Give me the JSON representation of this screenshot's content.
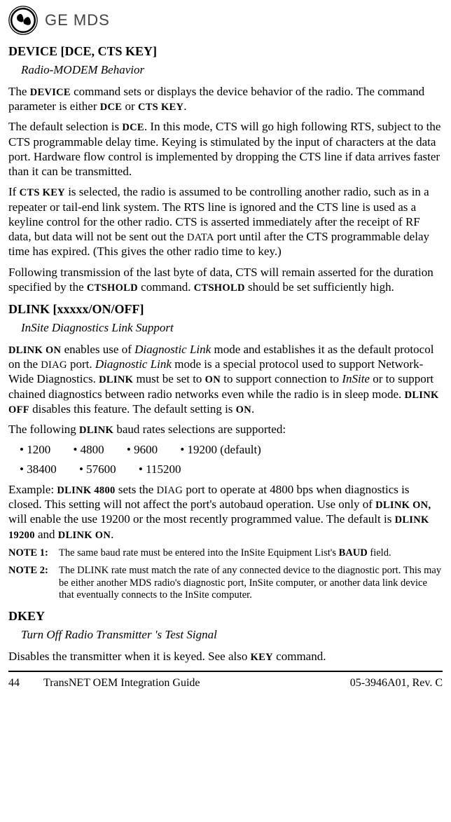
{
  "logo": {
    "brand_text": "GE MDS"
  },
  "sections": {
    "device": {
      "title": "DEVICE [DCE, CTS  KEY]",
      "subtitle": "Radio-MODEM Behavior",
      "p1_a": "The ",
      "p1_b": "DEVICE",
      "p1_c": " command sets or displays the device behavior of the radio. The command parameter is either ",
      "p1_d": "DCE",
      "p1_e": " or ",
      "p1_f": "CTS KEY",
      "p1_g": ".",
      "p2_a": "The default selection is ",
      "p2_b": "DCE",
      "p2_c": ". In this mode, CTS will go high following RTS, subject to the CTS programmable delay time. Keying is stimulated by the input of characters at the data port. Hardware flow control is implemented by dropping the CTS line if data arrives faster than it can be transmitted.",
      "p3_a": "If ",
      "p3_b": "CTS KEY",
      "p3_c": " is selected, the radio is assumed to be controlling another radio, such as in a repeater or tail-end link system. The RTS line is ignored and the CTS line is used as a keyline control for the other radio. CTS is asserted immediately after the receipt of RF data, but data will not be sent out the ",
      "p3_d": "DATA",
      "p3_e": " port until after the CTS programmable delay time has expired. (This gives the other radio time to key.)",
      "p4_a": "Following transmission of the last byte of data, CTS will remain asserted for the duration specified by the ",
      "p4_b": "CTSHOLD",
      "p4_c": " command. ",
      "p4_d": "CTSHOLD",
      "p4_e": " should be set sufficiently high."
    },
    "dlink": {
      "title": "DLINK [xxxxx/ON/OFF]",
      "subtitle": "InSite Diagnostics Link Support",
      "p1_a": "DLINK ON",
      "p1_b": " enables use of ",
      "p1_c": "Diagnostic Link",
      "p1_d": " mode and establishes it as the default protocol on the ",
      "p1_e": "DIAG",
      "p1_f": " port. ",
      "p1_g": "Diagnostic Link",
      "p1_h": " mode is a special protocol used to support Network-Wide Diagnostics. ",
      "p1_i": "DLINK",
      "p1_j": " must be set to ",
      "p1_k": "ON",
      "p1_l": " to support connection to ",
      "p1_m": "InSite",
      "p1_n": " or to support chained diagnostics between radio networks even while the radio is in sleep mode. ",
      "p1_o": "DLINK OFF",
      "p1_p": " disables this feature. The default setting is ",
      "p1_q": "ON",
      "p1_r": ".",
      "p2_a": "The following ",
      "p2_b": "DLINK",
      "p2_c": " baud rates selections are supported:",
      "baud_row1": [
        "• 1200",
        "• 4800",
        "• 9600",
        "• 19200 (default)"
      ],
      "baud_row2": [
        "• 38400",
        "• 57600",
        "• 115200"
      ],
      "p3_a": "Example: ",
      "p3_b": "DLINK 4800",
      "p3_c": " sets the ",
      "p3_d": "DIAG",
      "p3_e": " port to operate at 4800 bps when diagnostics is closed. This setting will not affect the port's autobaud operation. Use only of ",
      "p3_f": "DLINK ON,",
      "p3_g": " will enable the use 19200 or the most recently programmed value. The default is ",
      "p3_h": "DLINK 19200",
      "p3_i": " and ",
      "p3_j": "DLINK ON",
      "p3_k": ".",
      "note1_label": "NOTE 1:",
      "note1_a": "The same baud rate must be entered into the InSite Equipment List's ",
      "note1_b": "BAUD",
      "note1_c": " field.",
      "note2_label": "NOTE 2:",
      "note2_text": "The DLINK rate must match the rate of any connected device to the diagnostic port. This may be either another MDS radio's diagnostic port, InSite computer, or another data link device that eventually connects to the InSite computer."
    },
    "dkey": {
      "title": "DKEY",
      "subtitle": "Turn Off Radio Transmitter 's Test Signal",
      "p1_a": "Disables the transmitter when it is keyed. See also ",
      "p1_b": "KEY",
      "p1_c": " command."
    }
  },
  "footer": {
    "page": "44",
    "center": "TransNET OEM Integration Guide",
    "right": "05-3946A01, Rev. C"
  }
}
